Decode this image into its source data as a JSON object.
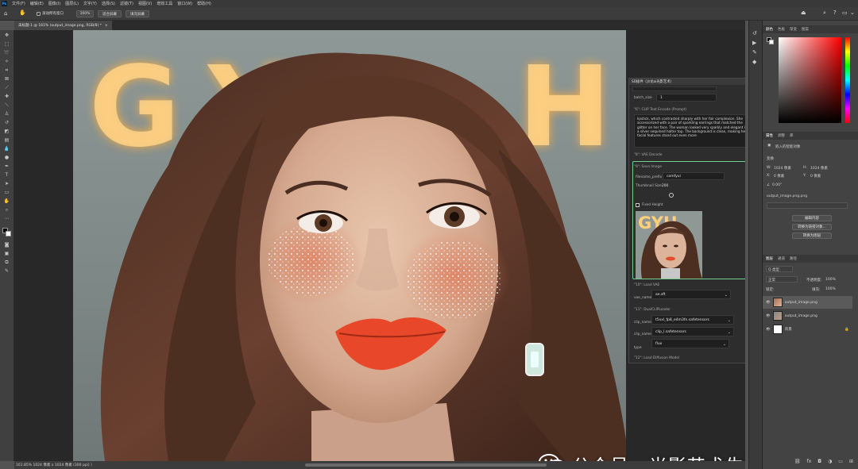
{
  "app": {
    "logo": "Ps"
  },
  "menu": [
    "文件(F)",
    "编辑(E)",
    "图像(I)",
    "图层(L)",
    "文字(Y)",
    "选择(S)",
    "滤镜(T)",
    "视图(V)",
    "增效工具",
    "窗口(W)",
    "帮助(H)"
  ],
  "options": {
    "scroll_all": "滚动所有窗口",
    "zoom": "100%",
    "fit_screen": "适合屏幕",
    "fill_screen": "填充屏幕"
  },
  "document": {
    "tab_title": "未标题-1 @ 161% (output_image.png, RGB/8) *",
    "tab_close": "×"
  },
  "status": {
    "text": "161.85% 1024 像素 x 1024 像素 (300 ppi)  〉"
  },
  "canvas": {
    "neon_text": "GYH"
  },
  "comfy": {
    "header": "SD插件（沙龙ai光影艺术）",
    "batch_label": "batch_size",
    "batch_value": "1",
    "clip_text_node": "\"6\": CLIP Text Encode (Prompt)",
    "prompt": "lipstick, which contrasted sharply with her fair complexion. She accessorized with a pair of sparkling earrings that matched the glitter on her face. The woman looked very sparkly and elegant in a silver sequined halter top. The background is clean, making her facial features stand out even more",
    "vae_decode_node": "\"8\": VAE Decode",
    "save_node": "\"9\": Save Image",
    "filename_label": "filename_prefix",
    "filename_value": "comfyui",
    "thumb_label": "Thumbnail Size",
    "thumb_value": "200",
    "fixed_height": "Fixed Height",
    "preview_text": "GYH",
    "load_vae_node": "\"10\": Load VAE",
    "vae_label": "vae_name",
    "vae_value": "ae.sft",
    "dualclip_node": "\"11\": DualCLIPLoader",
    "clip1_label": "clip_name1",
    "clip1_value": "t5xxl_fp8_e4m3fn.safetensors",
    "clip2_label": "clip_name2",
    "clip2_value": "clip_l.safetensors",
    "type_label": "type",
    "type_value": "flux",
    "diffusion_node": "\"12\": Load Diffusion Model"
  },
  "color_panel": {
    "tabs": [
      "颜色",
      "色板",
      "渐变",
      "图案"
    ]
  },
  "properties_panel": {
    "tabs": [
      "属性",
      "调整",
      "库"
    ],
    "object_type": "嵌入的智能对象",
    "transform_label": "变换",
    "w_label": "W:",
    "w_value": "1024 像素",
    "h_label": "H:",
    "h_value": "1024 像素",
    "x_label": "X:",
    "x_value": "0 像素",
    "y_label": "Y:",
    "y_value": "0 像素",
    "angle_value": "0.00°",
    "filename": "output_image.png.png",
    "edit_contents_btn": "编辑内容",
    "convert_linked_btn": "转换为链接对象...",
    "convert_layers_btn": "转换为图层"
  },
  "layers_panel": {
    "tabs": [
      "图层",
      "通道",
      "路径"
    ],
    "kind_filter": "Q 类型",
    "blend_mode": "正常",
    "opacity_label": "不透明度:",
    "opacity_value": "100%",
    "lock_label": "锁定:",
    "fill_label": "填充:",
    "fill_value": "100%",
    "layers": [
      {
        "name": "output_image.png",
        "thumb": "photo"
      },
      {
        "name": "output_image.png",
        "thumb": "photo-small"
      },
      {
        "name": "背景",
        "thumb": "white"
      }
    ]
  },
  "watermark": {
    "text": "公众号 · 光影艺术生活馆"
  },
  "colors": {
    "neon": "#ffc36b",
    "accent": "#31a8ff",
    "comfy_green": "#6fd08f"
  }
}
